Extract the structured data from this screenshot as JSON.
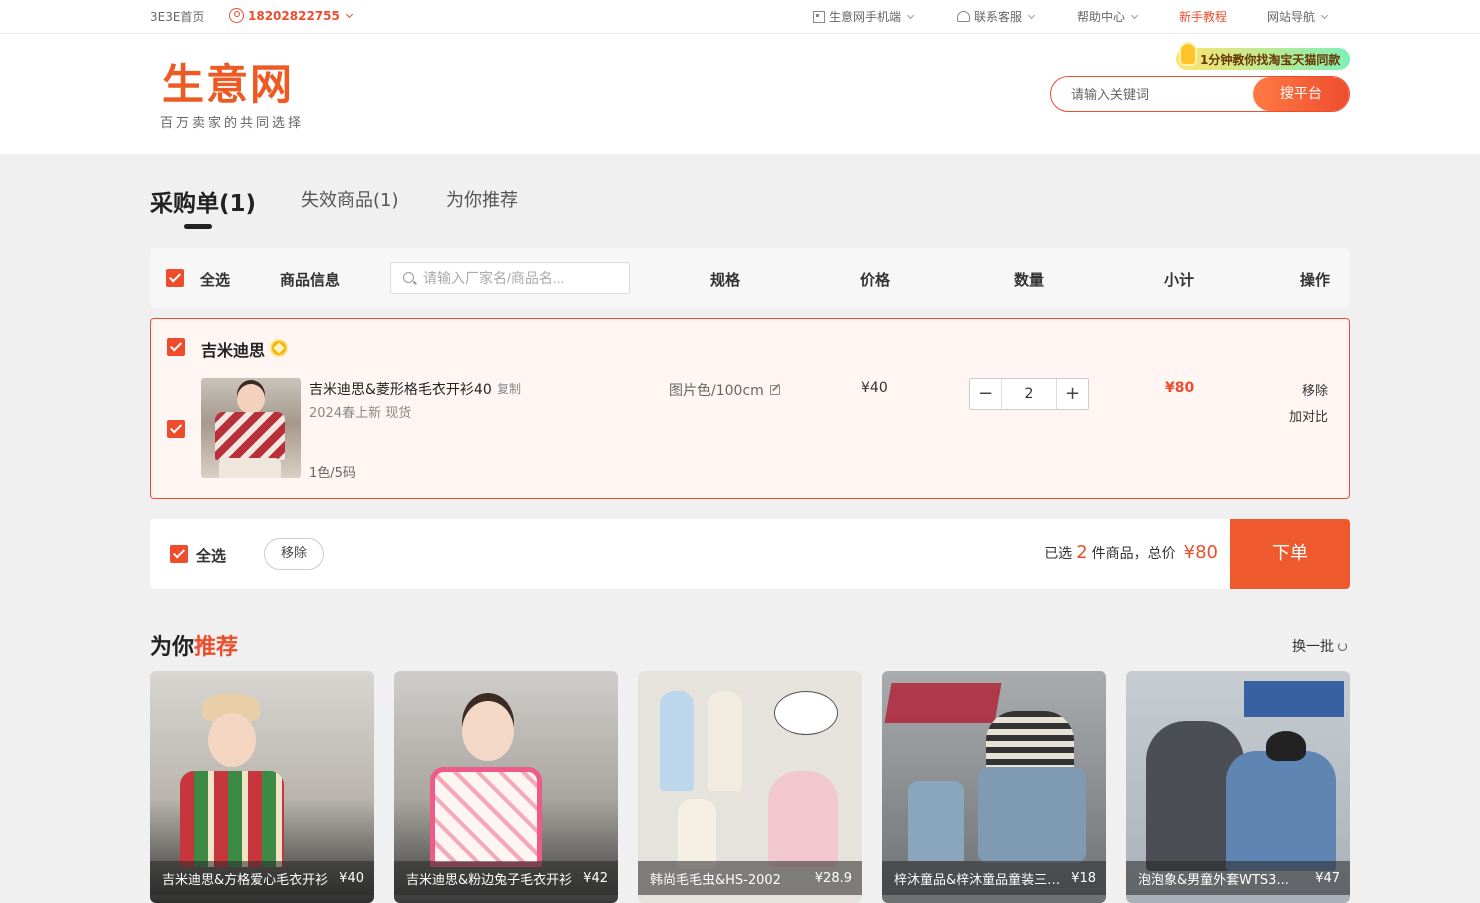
{
  "topbar": {
    "home": "3E3E首页",
    "phone": "18202822755",
    "mobile": "生意网手机端",
    "service": "联系客服",
    "help": "帮助中心",
    "tutorial": "新手教程",
    "sitenav": "网站导航"
  },
  "header": {
    "logo_main": "生意网",
    "logo_sub": "百万卖家的共同选择",
    "promo": "1分钟教你找淘宝天猫同款",
    "search_placeholder": "请输入关键词",
    "search_button": "搜平台"
  },
  "tabs": [
    {
      "label": "采购单(1)",
      "active": true
    },
    {
      "label": "失效商品(1)",
      "active": false
    },
    {
      "label": "为你推荐",
      "active": false
    }
  ],
  "table_header": {
    "select_all": "全选",
    "product_info": "商品信息",
    "filter_placeholder": "请输入厂家名/商品名...",
    "spec": "规格",
    "price": "价格",
    "quantity": "数量",
    "subtotal": "小计",
    "action": "操作"
  },
  "shop": {
    "name": "吉米迪思",
    "item": {
      "name": "吉米迪思&菱形格毛衣开衫40",
      "copy": "复制",
      "tag": "2024春上新  现货",
      "colors": "1色/5码",
      "spec": "图片色/100cm",
      "price": "¥40",
      "quantity": "2",
      "subtotal": "¥80",
      "remove": "移除",
      "compare": "加对比"
    }
  },
  "footer": {
    "select_all": "全选",
    "remove": "移除",
    "selected_prefix": "已选",
    "selected_count": "2",
    "selected_suffix": "件商品，总价",
    "total": "¥80",
    "order_button": "下单"
  },
  "recommend": {
    "title_a": "为你",
    "title_b": "推荐",
    "refresh": "换一批",
    "items": [
      {
        "name": "吉米迪思&方格爱心毛衣开衫",
        "price": "¥40"
      },
      {
        "name": "吉米迪思&粉边兔子毛衣开衫",
        "price": "¥42"
      },
      {
        "name": "韩尚毛毛虫&HS-2002",
        "price": "¥28.9"
      },
      {
        "name": "梓沐童品&梓沐童品童装三件套",
        "price": "¥18"
      },
      {
        "name": "泡泡象&男童外套WTS3...",
        "price": "¥47"
      }
    ]
  },
  "colors": {
    "accent": "#ee4d2d",
    "page_bg": "#f0f0f0"
  }
}
